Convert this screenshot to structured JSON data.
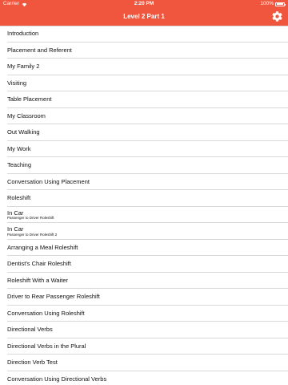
{
  "status_bar": {
    "carrier": "Carrier",
    "time": "2:20 PM",
    "battery": "100%",
    "battery_level": 1.0
  },
  "nav": {
    "title": "Level 2 Part 1",
    "settings_icon": "gear-icon",
    "accent_color": "#f0563d"
  },
  "lessons": [
    {
      "title": "Introduction"
    },
    {
      "title": "Placement and Referent"
    },
    {
      "title": "My Family 2"
    },
    {
      "title": "Visiting"
    },
    {
      "title": "Table Placement"
    },
    {
      "title": "My Classroom"
    },
    {
      "title": "Out Walking"
    },
    {
      "title": "My Work"
    },
    {
      "title": "Teaching"
    },
    {
      "title": "Conversation Using Placement"
    },
    {
      "title": "Roleshift"
    },
    {
      "title": "In Car",
      "subtitle": "Passenger to Driver Roleshift"
    },
    {
      "title": "In Car",
      "subtitle": "Passenger to Driver Roleshift 2"
    },
    {
      "title": "Arranging a Meal Roleshift"
    },
    {
      "title": "Dentist's Chair Roleshift"
    },
    {
      "title": "Roleshift With a Waiter"
    },
    {
      "title": "Driver to Rear Passenger Roleshift"
    },
    {
      "title": "Conversation Using Roleshift"
    },
    {
      "title": "Directional Verbs"
    },
    {
      "title": "Directional Verbs in the Plural"
    },
    {
      "title": "Direction Verb Test"
    },
    {
      "title": "Conversation Using Directional Verbs"
    }
  ]
}
